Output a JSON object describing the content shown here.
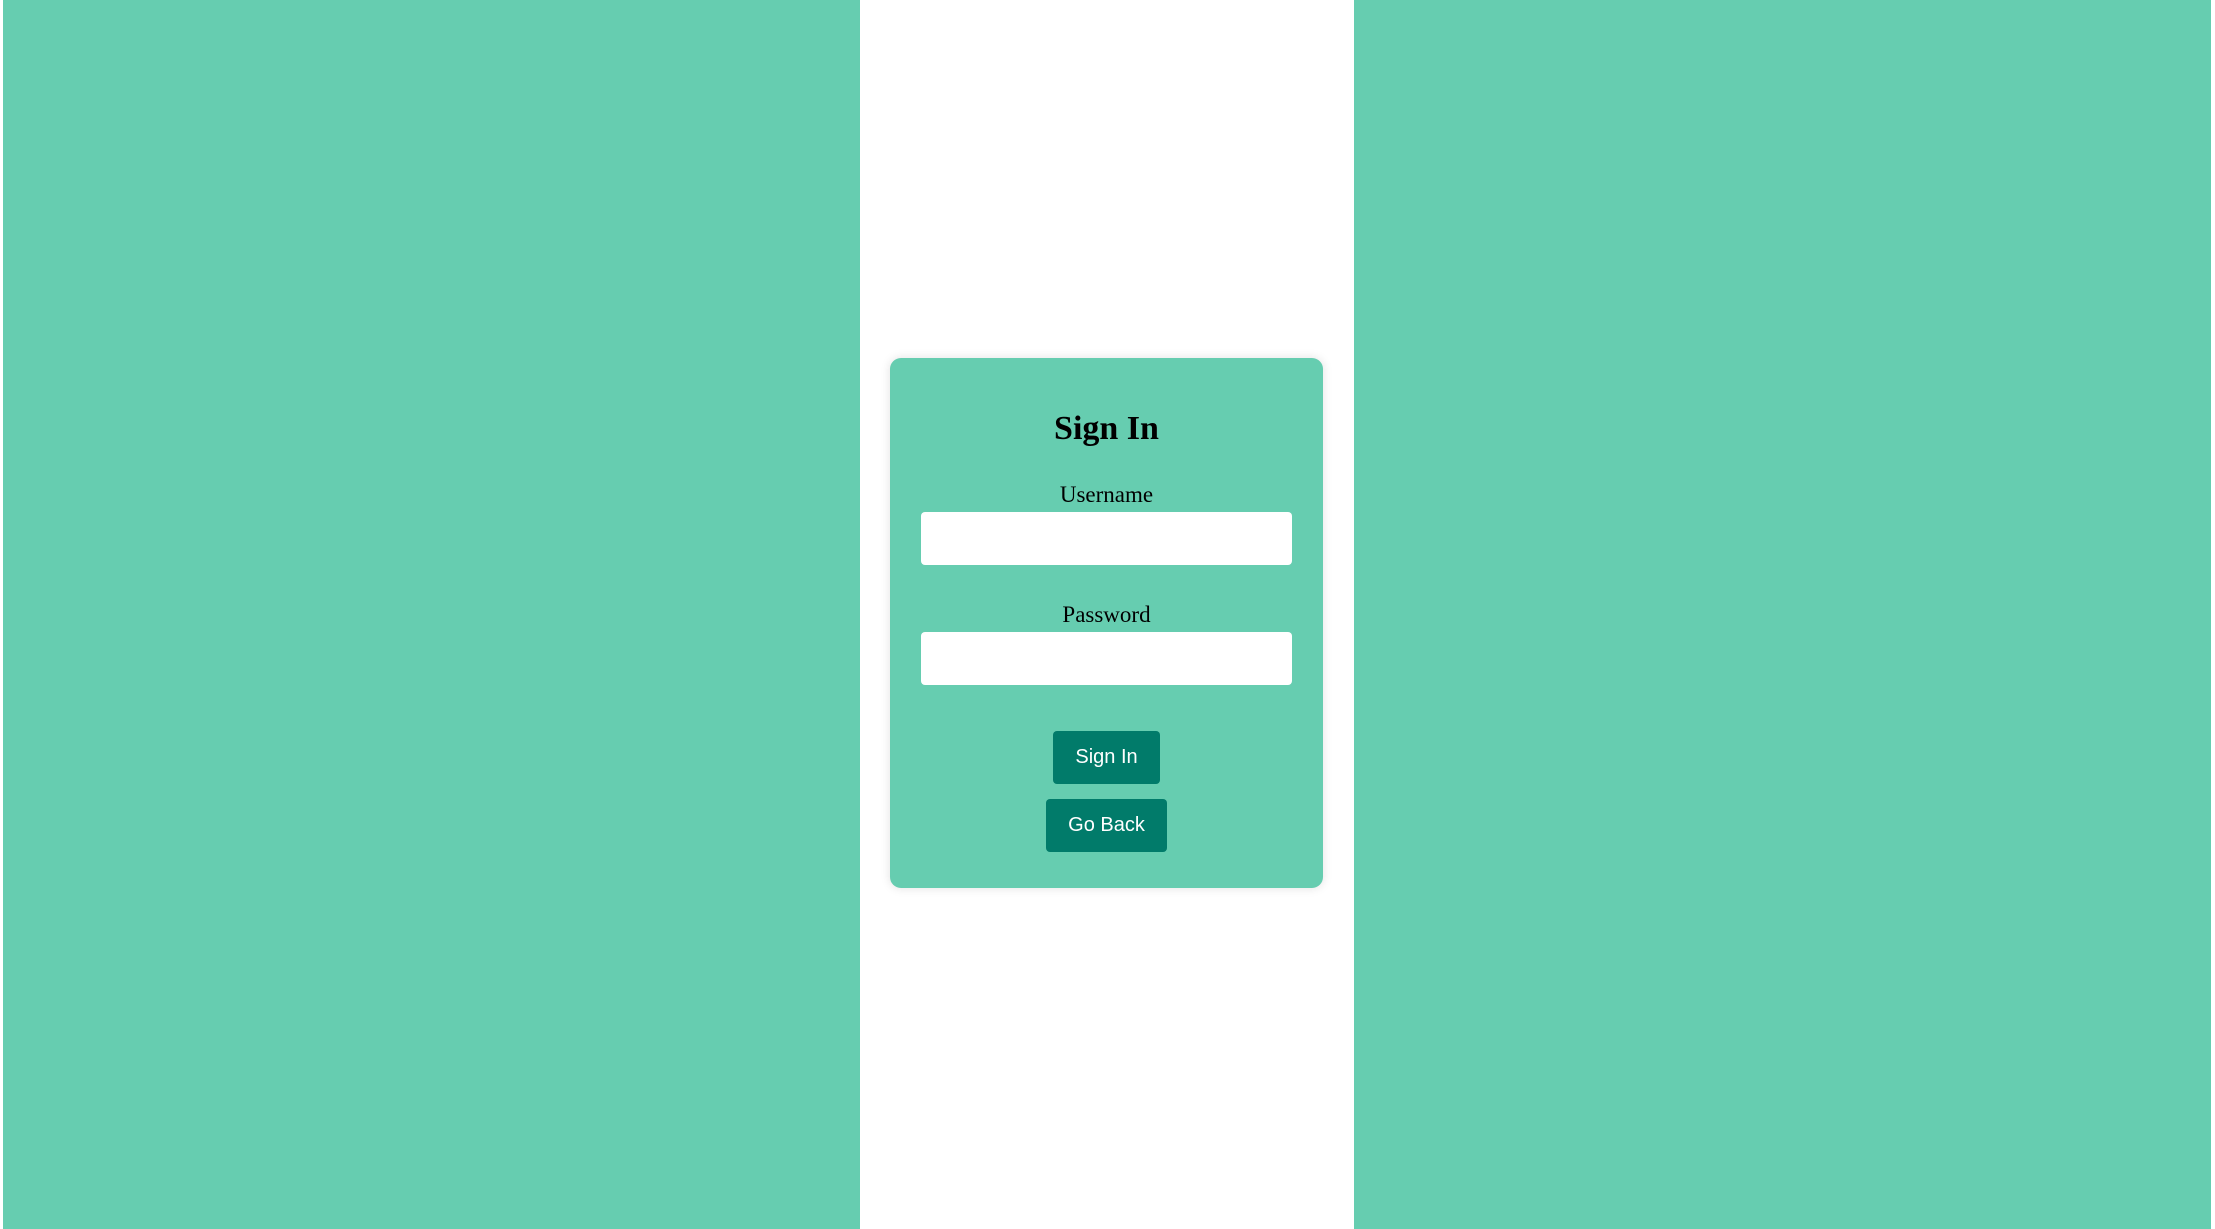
{
  "theme": {
    "background": "#ffffff",
    "panel_color": "#66cdb0",
    "card_color": "#66cdb0",
    "button_color": "#017b6a",
    "text_color": "#000000",
    "button_text_color": "#ffffff"
  },
  "form": {
    "title": "Sign In",
    "username_label": "Username",
    "username_value": "",
    "password_label": "Password",
    "password_value": "",
    "sign_in_label": "Sign In",
    "go_back_label": "Go Back"
  }
}
